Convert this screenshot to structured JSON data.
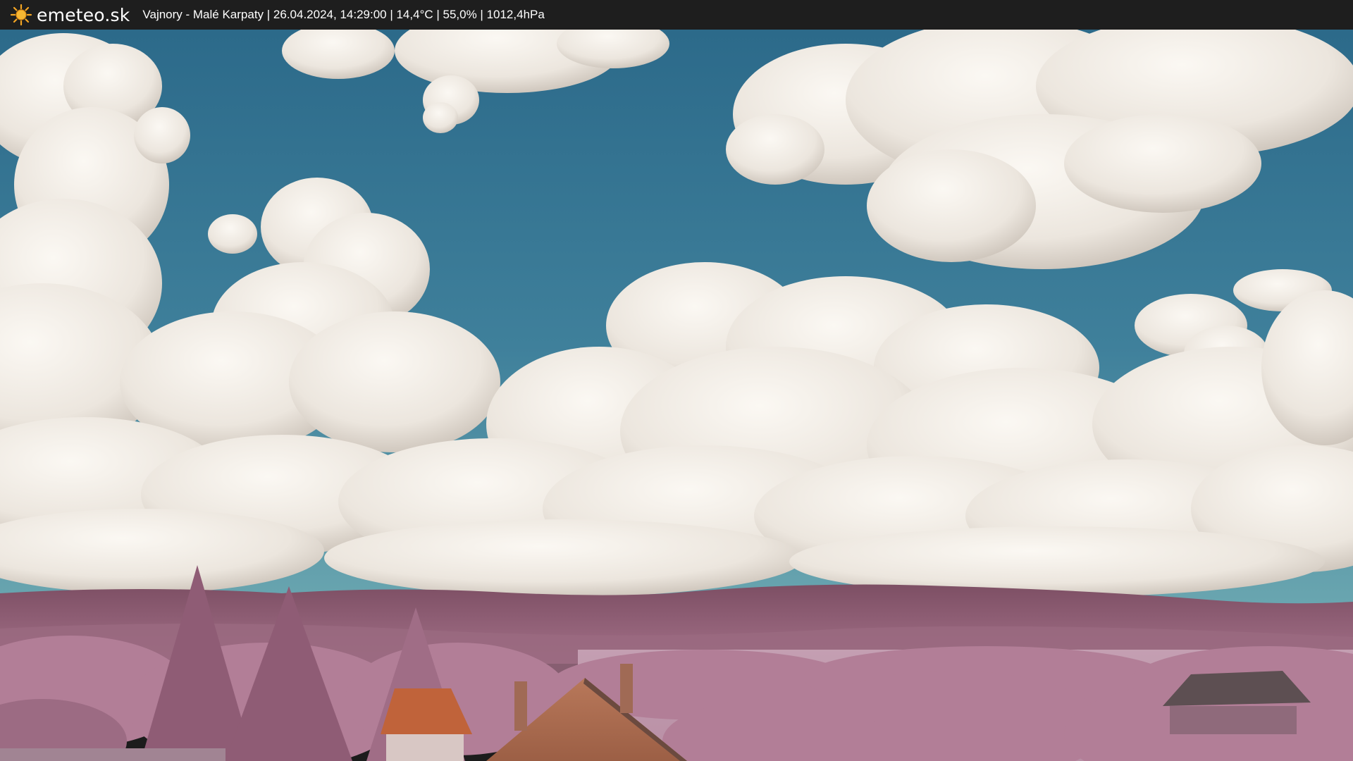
{
  "topbar": {
    "brand": "emeteo.sk",
    "caption": "Vajnory - Malé Karpaty | 26.04.2024, 14:29:00 | 14,4°C | 55,0% | 1012,4hPa",
    "logo_icon": "sun-icon"
  },
  "colors": {
    "bar": "#1e1e1e",
    "sun": "#f5a623",
    "sky_top": "#2f6f8f",
    "sky_bottom": "#5a98a8",
    "cloud": "#f2eee8",
    "cloud_shadow": "#cfc7bd",
    "foliage": "#b27e97",
    "hills": "#8a5b70",
    "roof": "#c0633a"
  }
}
